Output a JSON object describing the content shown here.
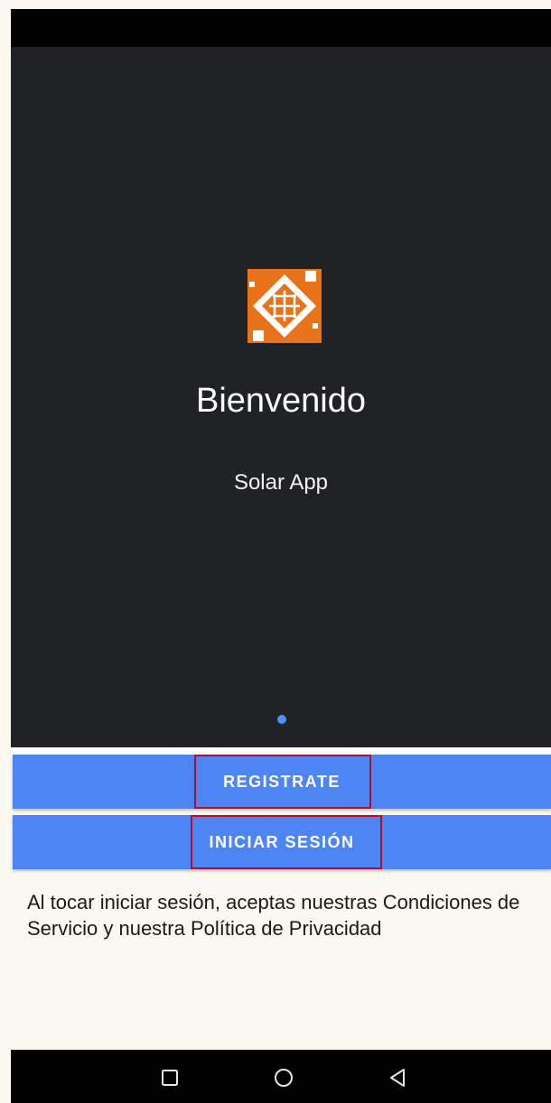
{
  "welcome": {
    "title": "Bienvenido",
    "subtitle": "Solar App",
    "logo_icon": "solar-app-logo",
    "page_indicator": {
      "current": 1,
      "total": 1
    }
  },
  "buttons": {
    "register_label": "REGISTRATE",
    "login_label": "INICIAR SESIÓN"
  },
  "terms_text": "Al tocar iniciar sesión, aceptas nuestras Condiciones de Servicio y nuestra Política de Privacidad",
  "nav_bar": {
    "icons": [
      "recent-apps-icon",
      "home-icon",
      "back-icon"
    ]
  },
  "colors": {
    "hero_bg": "#212225",
    "button_bg": "#4d86f4",
    "logo_orange": "#e8731a",
    "highlight_border": "#b0102a"
  }
}
